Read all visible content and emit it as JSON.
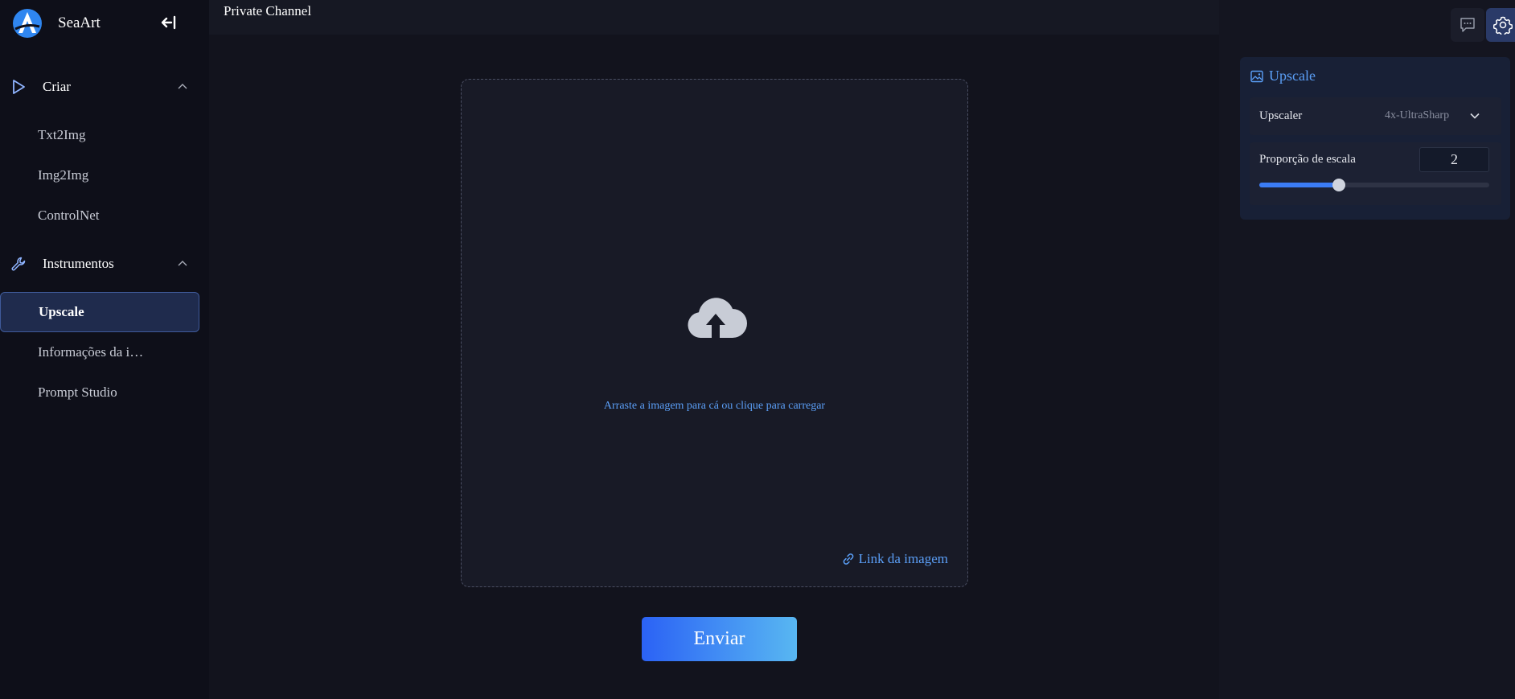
{
  "brand": {
    "name": "SeaArt"
  },
  "sidebar": {
    "sections": [
      {
        "label": "Criar",
        "icon": "play-outline-icon",
        "items": [
          "Txt2Img",
          "Img2Img",
          "ControlNet"
        ]
      },
      {
        "label": "Instrumentos",
        "icon": "wrench-icon",
        "items": [
          "Upscale",
          "Informações da i…",
          "Prompt Studio"
        ]
      }
    ],
    "active_item": "Upscale"
  },
  "topbar": {
    "title": "Private Channel"
  },
  "upload": {
    "icon": "cloud-upload-icon",
    "hint": "Arraste a imagem para cá ou clique para carregar",
    "link_label": "Link da imagem"
  },
  "actions": {
    "submit_label": "Enviar"
  },
  "right_panel": {
    "title": "Upscale",
    "upscaler_label": "Upscaler",
    "upscaler_value": "4x-UltraSharp",
    "scale_label": "Proporção de escala",
    "scale_value": "2",
    "scale_slider_fraction": 0.347
  },
  "colors": {
    "accent": "#5b9ff7",
    "button_gradient_start": "#2b62f5",
    "button_gradient_end": "#58b7f2",
    "active_nav_bg": "#1f2b4d"
  }
}
